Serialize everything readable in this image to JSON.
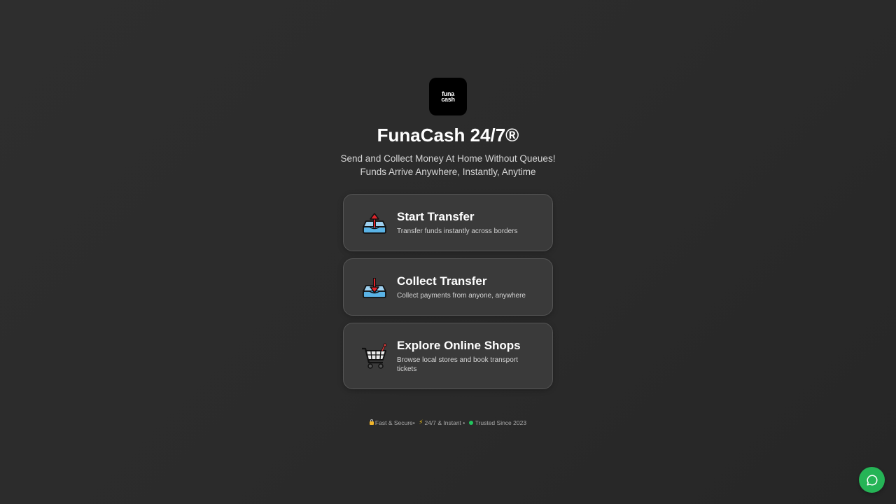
{
  "brand": {
    "logo_line1": "funa",
    "logo_line2": "cash",
    "title": "FunaCash 24/7®",
    "subtitle_line1": "Send and Collect Money At Home Without Queues!",
    "subtitle_line2": "Funds Arrive Anywhere, Instantly, Anytime"
  },
  "actions": [
    {
      "title": "Start Transfer",
      "description": "Transfer funds instantly across borders",
      "icon": "outbox-tray-icon"
    },
    {
      "title": "Collect Transfer",
      "description": "Collect payments from anyone, anywhere",
      "icon": "inbox-tray-icon"
    },
    {
      "title": "Explore Online Shops",
      "description": "Browse local stores and book transport tickets",
      "icon": "shopping-cart-icon"
    }
  ],
  "footer": {
    "item1": "Fast & Secure",
    "sep1": "•",
    "item2": "24/7 & Instant",
    "sep2": "•",
    "item3": "Trusted Since 2023"
  },
  "colors": {
    "background": "#2b2b2b",
    "card": "#3a3a3a",
    "chat_button": "#25b456",
    "trusted_dot": "#22c55e"
  }
}
